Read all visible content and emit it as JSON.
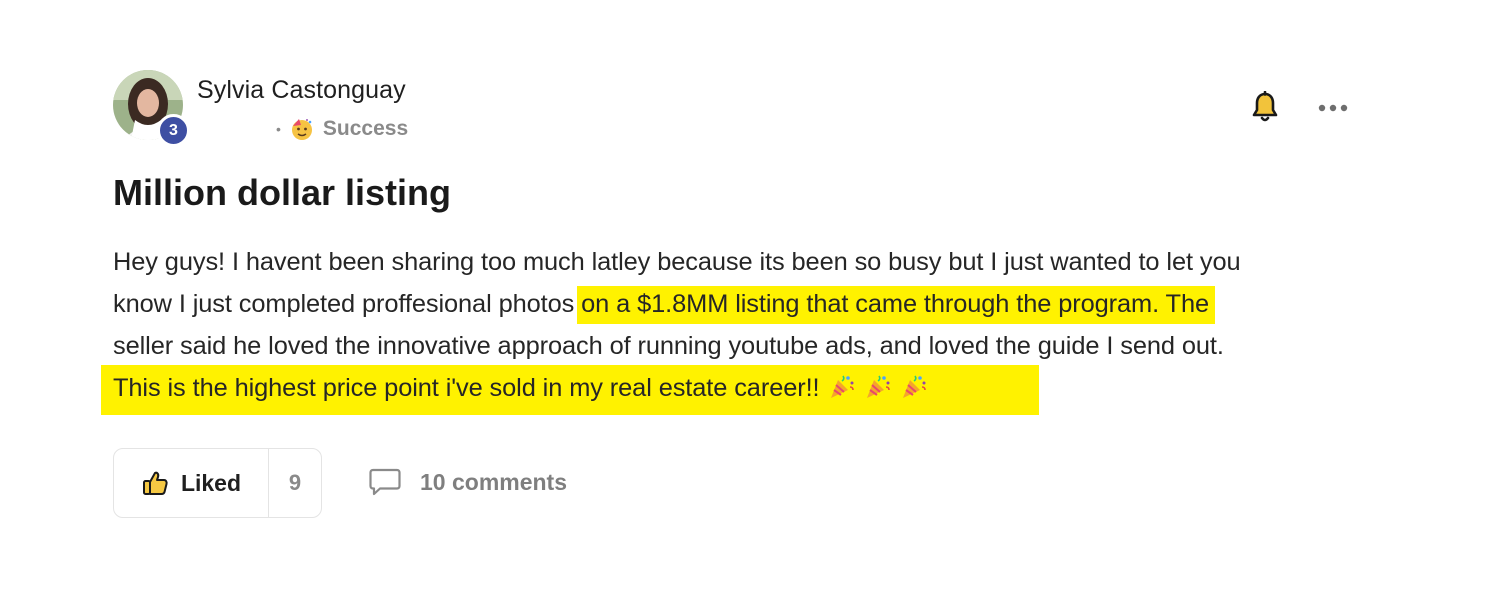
{
  "author": {
    "name": "Sylvia Castonguay",
    "level": "3",
    "avatar_icon": "profile-photo"
  },
  "meta": {
    "separator": "•",
    "category_icon": "party-face-icon",
    "category": "Success"
  },
  "actions": {
    "bell_icon": "bell-icon",
    "more_icon": "more-horizontal-icon"
  },
  "post": {
    "title": "Million dollar listing",
    "lines": [
      {
        "plain": "Hey guys! I havent been sharing too much latley because its been so busy but I just wanted to let you"
      },
      {
        "plain": "know I just completed proffesional photos ",
        "highlight": "on a $1.8MM listing that came through the program. The"
      },
      {
        "plain": "seller said he loved the innovative approach of running youtube ads, and loved the guide I send out."
      },
      {
        "highlight": "This is the highest price point i've sold in my real estate career!!"
      }
    ],
    "highlight_color": "#fff200",
    "trailing_emoji_icon": "party-popper-icon",
    "trailing_emoji_count": 3
  },
  "footer": {
    "like_icon": "thumbs-up-icon",
    "like_label": "Liked",
    "like_count": "9",
    "comment_icon": "comment-bubble-icon",
    "comments_label": "10 comments"
  },
  "colors": {
    "level_badge": "#3e4fa3",
    "muted_text": "#8a8a8a",
    "like_icon_fill": "#f5c843"
  }
}
